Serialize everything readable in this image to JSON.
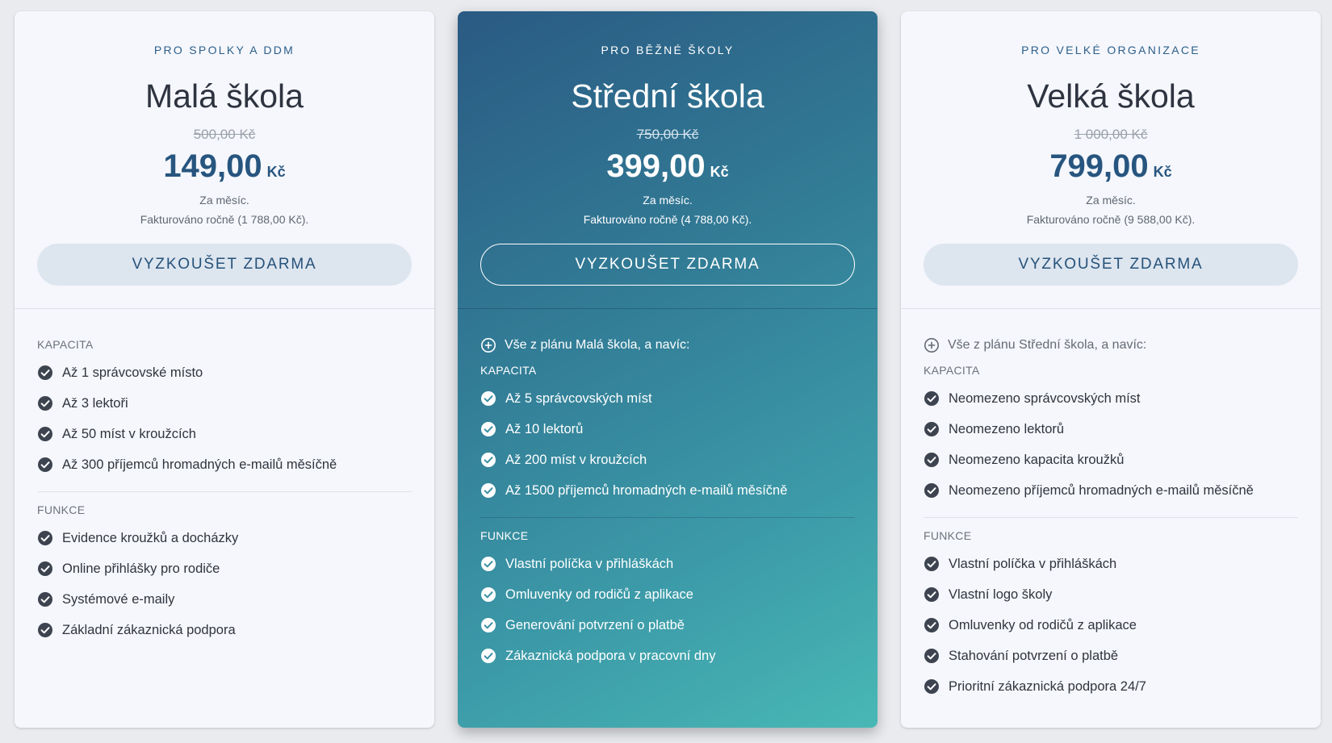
{
  "plans": [
    {
      "eyebrow": "PRO SPOLKY A DDM",
      "title": "Malá škola",
      "old_price": "500,00 Kč",
      "price": "149,00",
      "currency": "Kč",
      "per_month": "Za měsíc.",
      "billing": "Fakturováno ročně (1 788,00 Kč).",
      "cta_label": "VYZKOUŠET ZDARMA",
      "capacity_label": "KAPACITA",
      "capacity": [
        "Až 1 správcovské místo",
        "Až 3 lektoři",
        "Až 50 míst v kroužcích",
        "Až 300 příjemců hromadných e-mailů měsíčně"
      ],
      "features_label": "FUNKCE",
      "features": [
        "Evidence kroužků a docházky",
        "Online přihlášky pro rodiče",
        "Systémové e-maily",
        "Základní zákaznická podpora"
      ]
    },
    {
      "eyebrow": "PRO BĚŽNÉ ŠKOLY",
      "title": "Střední škola",
      "old_price": "750,00 Kč",
      "price": "399,00",
      "currency": "Kč",
      "per_month": "Za měsíc.",
      "billing": "Fakturováno ročně (4 788,00 Kč).",
      "cta_label": "VYZKOUŠET ZDARMA",
      "includes": "Vše z plánu Malá škola, a navíc:",
      "capacity_label": "KAPACITA",
      "capacity": [
        "Až 5 správcovských míst",
        "Až 10 lektorů",
        "Až 200 míst v kroužcích",
        "Až 1500 příjemců hromadných e-mailů měsíčně"
      ],
      "features_label": "FUNKCE",
      "features": [
        "Vlastní políčka v přihláškách",
        "Omluvenky od rodičů z aplikace",
        "Generování potvrzení o platbě",
        "Zákaznická podpora v pracovní dny"
      ]
    },
    {
      "eyebrow": "PRO VELKÉ ORGANIZACE",
      "title": "Velká škola",
      "old_price": "1 000,00 Kč",
      "price": "799,00",
      "currency": "Kč",
      "per_month": "Za měsíc.",
      "billing": "Fakturováno ročně (9 588,00 Kč).",
      "cta_label": "VYZKOUŠET ZDARMA",
      "includes": "Vše z plánu Střední škola, a navíc:",
      "capacity_label": "KAPACITA",
      "capacity": [
        "Neomezeno správcovských míst",
        "Neomezeno lektorů",
        "Neomezeno kapacita kroužků",
        "Neomezeno příjemců hromadných e-mailů měsíčně"
      ],
      "features_label": "FUNKCE",
      "features": [
        "Vlastní políčka v přihláškách",
        "Vlastní logo školy",
        "Omluvenky od rodičů z aplikace",
        "Stahování potvrzení o platbě",
        "Prioritní zákaznická podpora 24/7"
      ]
    }
  ],
  "icons": {
    "feature": "check-circle-icon",
    "includes": "plus-circle-icon"
  },
  "colors": {
    "accent": "#27557f",
    "featured_gradient_start": "#2a5a83",
    "featured_gradient_end": "#48b8b5",
    "check_plain": "#3d4450",
    "check_featured": "#ffffff"
  }
}
